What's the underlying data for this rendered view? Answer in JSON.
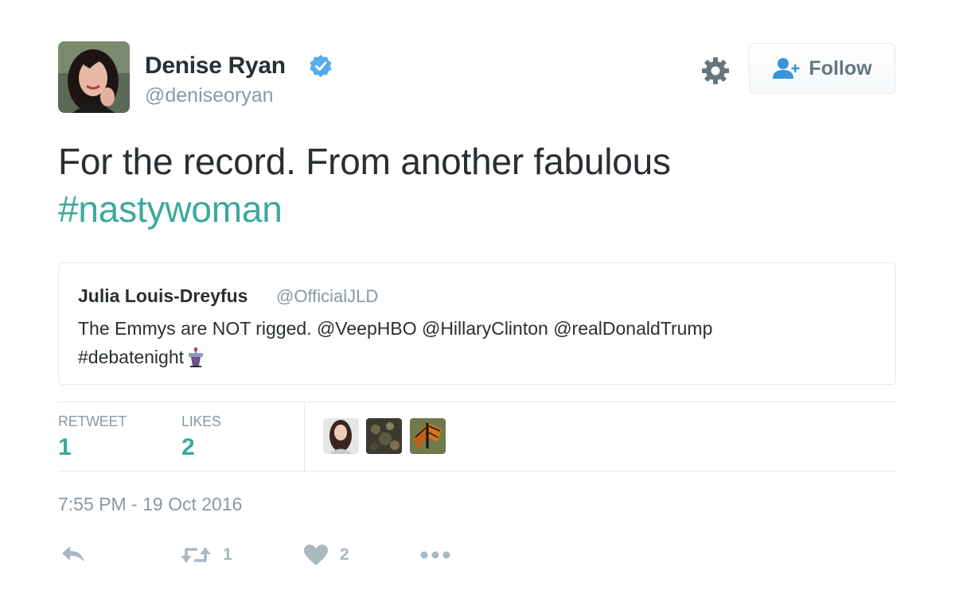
{
  "author": {
    "name": "Denise Ryan",
    "handle": "@deniseoryan",
    "verified": true
  },
  "follow_button": {
    "label": "Follow"
  },
  "tweet": {
    "text": "For the record. From another fabulous",
    "hashtag": "#nastywoman"
  },
  "quoted_tweet": {
    "name": "Julia Louis-Dreyfus",
    "handle": "@OfficialJLD",
    "line1": "The Emmys are NOT rigged. @VeepHBO @HillaryClinton @realDonaldTrump",
    "line2": "#debatenight"
  },
  "stats": {
    "retweet_label": "RETWEET",
    "retweet_count": "1",
    "likes_label": "LIKES",
    "likes_count": "2"
  },
  "timestamp": "7:55 PM - 19 Oct 2016",
  "actions": {
    "retweet_count": "1",
    "like_count": "2"
  },
  "icons": [
    "verified-badge-icon",
    "gear-icon",
    "follow-person-icon",
    "podium-icon",
    "reply-icon",
    "retweet-icon",
    "heart-icon",
    "more-icon"
  ],
  "colors": {
    "hashtag": "#3ba99c",
    "stat_value": "#3ba99c",
    "verified": "#55acee",
    "secondary_text": "#8899a6",
    "icon_gray": "#aab8c2"
  }
}
